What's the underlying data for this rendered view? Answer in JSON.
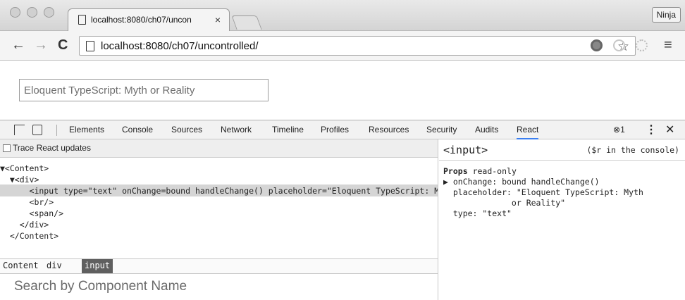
{
  "browser": {
    "tab_title": "localhost:8080/ch07/uncon",
    "tab_close": "×",
    "profile_button": "Ninja",
    "url": "localhost:8080/ch07/uncontrolled/"
  },
  "page": {
    "input_placeholder": "Eloquent TypeScript: Myth or Reality"
  },
  "devtools": {
    "tabs": [
      "Elements",
      "Console",
      "Sources",
      "Network",
      "Timeline",
      "Profiles",
      "Resources",
      "Security",
      "Audits",
      "React"
    ],
    "active_tab": "React",
    "error_count": "1",
    "trace_label": "Trace React updates",
    "tree": [
      "▼<Content>",
      "  ▼<div>",
      "      <input type=\"text\" onChange=bound handleChange() placeholder=\"Eloquent TypeScript: Myth or Reality\"/>",
      "      <br/>",
      "      <span/>",
      "    </div>",
      "  </Content>"
    ],
    "breadcrumbs": [
      "Content",
      "div",
      "input"
    ],
    "search_placeholder": "Search by Component Name",
    "inspector": {
      "tag": "<input>",
      "hint": "($r in the console)",
      "props_header": "Props",
      "props_note": "read-only",
      "props": [
        "▶ onChange: bound handleChange()",
        "  placeholder: \"Eloquent TypeScript: Myth",
        "              or Reality\"",
        "  type: \"text\""
      ]
    }
  },
  "colors": {
    "accent": "#3b7ff0",
    "selected_row": "#d5d5d5",
    "active_crumb": "#5f5f5f"
  }
}
